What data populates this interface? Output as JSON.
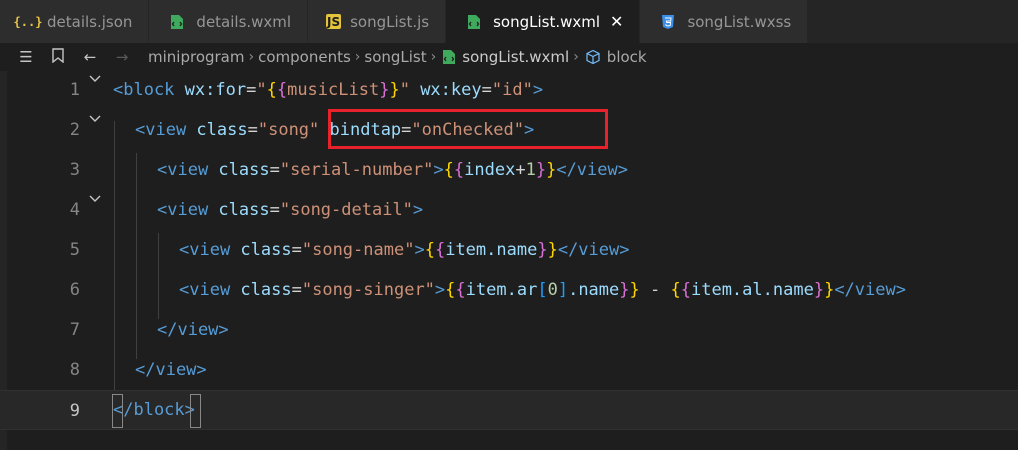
{
  "tabs": [
    {
      "name": "details.json",
      "icon": "json-braces-icon",
      "active": false
    },
    {
      "name": "details.wxml",
      "icon": "wxml-file-icon",
      "active": false
    },
    {
      "name": "songList.js",
      "icon": "js-file-icon",
      "active": false
    },
    {
      "name": "songList.wxml",
      "icon": "wxml-file-icon",
      "active": true
    },
    {
      "name": "songList.wxss",
      "icon": "css-file-icon",
      "active": false
    }
  ],
  "breadcrumb": {
    "items": [
      "miniprogram",
      "components",
      "songList",
      "songList.wxml",
      "block"
    ]
  },
  "editor": {
    "current_line": 9,
    "lines": [
      {
        "n": "1"
      },
      {
        "n": "2"
      },
      {
        "n": "3"
      },
      {
        "n": "4"
      },
      {
        "n": "5"
      },
      {
        "n": "6"
      },
      {
        "n": "7"
      },
      {
        "n": "8"
      },
      {
        "n": "9"
      }
    ],
    "tokens": {
      "l1": [
        "<block",
        " wx:for",
        "=",
        "\"",
        "{",
        "{",
        "musicList",
        "}",
        "}",
        "\"",
        " wx:key",
        "=",
        "\"id\"",
        ">"
      ],
      "l2": [
        "<view",
        " class",
        "=",
        "\"song\"",
        " bindtap",
        "=",
        "\"onChecked\"",
        ">"
      ],
      "l3": [
        "<view",
        " class",
        "=",
        "\"serial-number\"",
        ">",
        "{",
        "{",
        "index",
        "+",
        "1",
        "}",
        "}",
        "</view",
        ">"
      ],
      "l4": [
        "<view",
        " class",
        "=",
        "\"song-detail\"",
        ">"
      ],
      "l5": [
        "<view",
        " class",
        "=",
        "\"song-name\"",
        ">",
        "{",
        "{",
        "item.name",
        "}",
        "}",
        "</view",
        ">"
      ],
      "l6": [
        "<view",
        " class",
        "=",
        "\"song-singer\"",
        ">",
        "{",
        "{",
        "item.ar",
        "[",
        "0",
        "]",
        ".name",
        "}",
        "}",
        " - ",
        "{",
        "{",
        "item.al.name",
        "}",
        "}",
        "</view",
        ">"
      ],
      "l7": [
        "</view",
        ">"
      ],
      "l8": [
        "</view",
        ">"
      ],
      "l9": [
        "</block",
        ">"
      ]
    }
  },
  "colors": {
    "tag": "#569cd6",
    "attr": "#9cdcfe",
    "string": "#ce9178",
    "highlight": "#e8222a"
  }
}
